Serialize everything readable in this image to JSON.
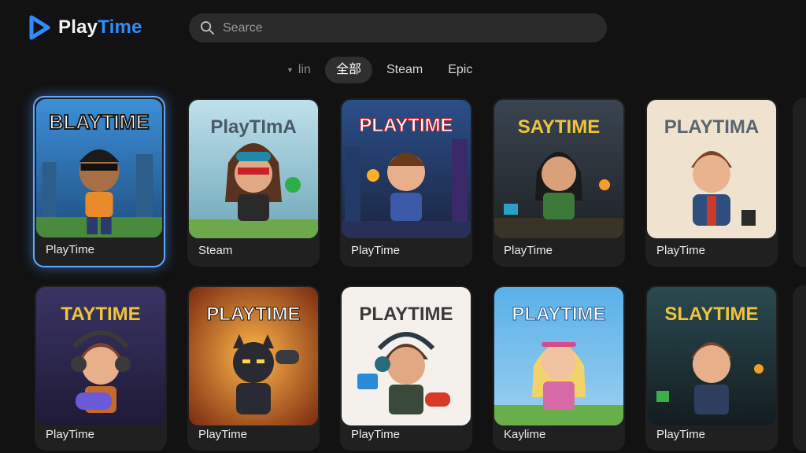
{
  "app": {
    "title_part1": "Play",
    "title_part2": "Time"
  },
  "search": {
    "placeholder": "Searce"
  },
  "filters": {
    "sort_label": "lin",
    "tabs": [
      {
        "label": "全部",
        "active": true
      },
      {
        "label": "Steam",
        "active": false
      },
      {
        "label": "Epic",
        "active": false
      }
    ]
  },
  "colors": {
    "accent": "#2f8dff",
    "background": "#121212",
    "card": "#202020",
    "selected_glow": "#5fa8ff"
  },
  "games": [
    {
      "label": "PlayTime",
      "art_title": "BLAYTIME",
      "theme": "blue-city",
      "character": "boy-sunglasses",
      "selected": true
    },
    {
      "label": "Steam",
      "art_title": "PlayTImA",
      "theme": "pale-sky",
      "character": "goggles-hero",
      "selected": false
    },
    {
      "label": "PlayTime",
      "art_title": "PLAYTIME",
      "theme": "neon-city",
      "character": "boy-torch",
      "selected": false
    },
    {
      "label": "PlayTime",
      "art_title": "SAYTIME",
      "theme": "dark-ruins",
      "character": "girl-green-jacket",
      "selected": false
    },
    {
      "label": "PlayTime",
      "art_title": "PLAYTIMA",
      "theme": "cream",
      "character": "boy-denim",
      "selected": false
    },
    {
      "label": "PlayTime",
      "art_title": "TAYTIME",
      "theme": "purple-city",
      "character": "boy-headphones",
      "selected": false
    },
    {
      "label": "PlayTime",
      "art_title": "PLAYTIME",
      "theme": "orange-burst",
      "character": "dark-cat",
      "selected": false
    },
    {
      "label": "PlayTime",
      "art_title": "PLAYTIME",
      "theme": "white",
      "character": "gamer-headset",
      "selected": false
    },
    {
      "label": "Kaylime",
      "art_title": "PLAYTIME",
      "theme": "sky-grass",
      "character": "blonde-girl",
      "selected": false
    },
    {
      "label": "PlayTime",
      "art_title": "SLAYTIME",
      "theme": "dark-teal",
      "character": "boy-brown",
      "selected": false
    }
  ]
}
